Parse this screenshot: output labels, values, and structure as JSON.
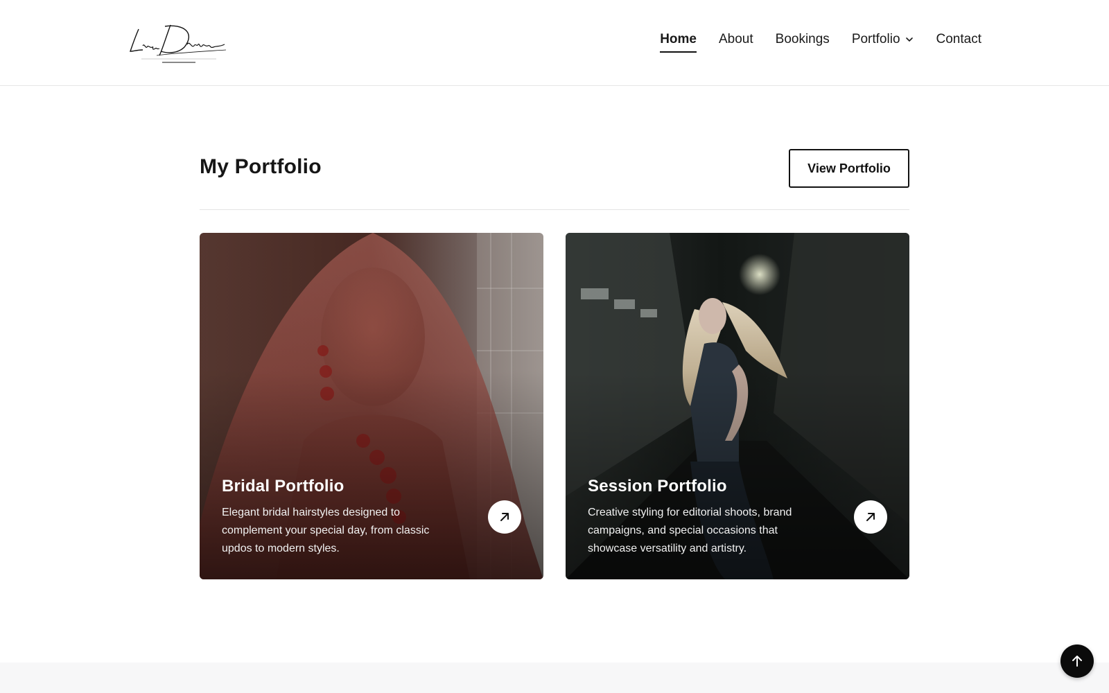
{
  "brand": {
    "logo_icon": "lizz-davies-signature-logo"
  },
  "nav": {
    "items": [
      {
        "label": "Home",
        "active": true
      },
      {
        "label": "About",
        "active": false
      },
      {
        "label": "Bookings",
        "active": false
      },
      {
        "label": "Portfolio",
        "active": false,
        "has_dropdown": true,
        "icon": "chevron-down-icon"
      },
      {
        "label": "Contact",
        "active": false
      }
    ]
  },
  "portfolio_section": {
    "title": "My Portfolio",
    "button_label": "View Portfolio",
    "cards": [
      {
        "title": "Bridal Portfolio",
        "description": "Elegant bridal hairstyles designed to complement your special day, from classic updos to modern styles.",
        "icon": "arrow-up-right-icon"
      },
      {
        "title": "Session Portfolio",
        "description": "Creative styling for editorial shoots, brand campaigns, and special occasions that showcase versatility and artistry.",
        "icon": "arrow-up-right-icon"
      }
    ]
  },
  "back_to_top": {
    "icon": "arrow-up-icon"
  },
  "colors": {
    "text": "#111111",
    "border": "#e4e4e4",
    "button_border": "#111111",
    "back_to_top_bg": "#0b0b0b",
    "footer_bg": "#f7f7f8"
  }
}
